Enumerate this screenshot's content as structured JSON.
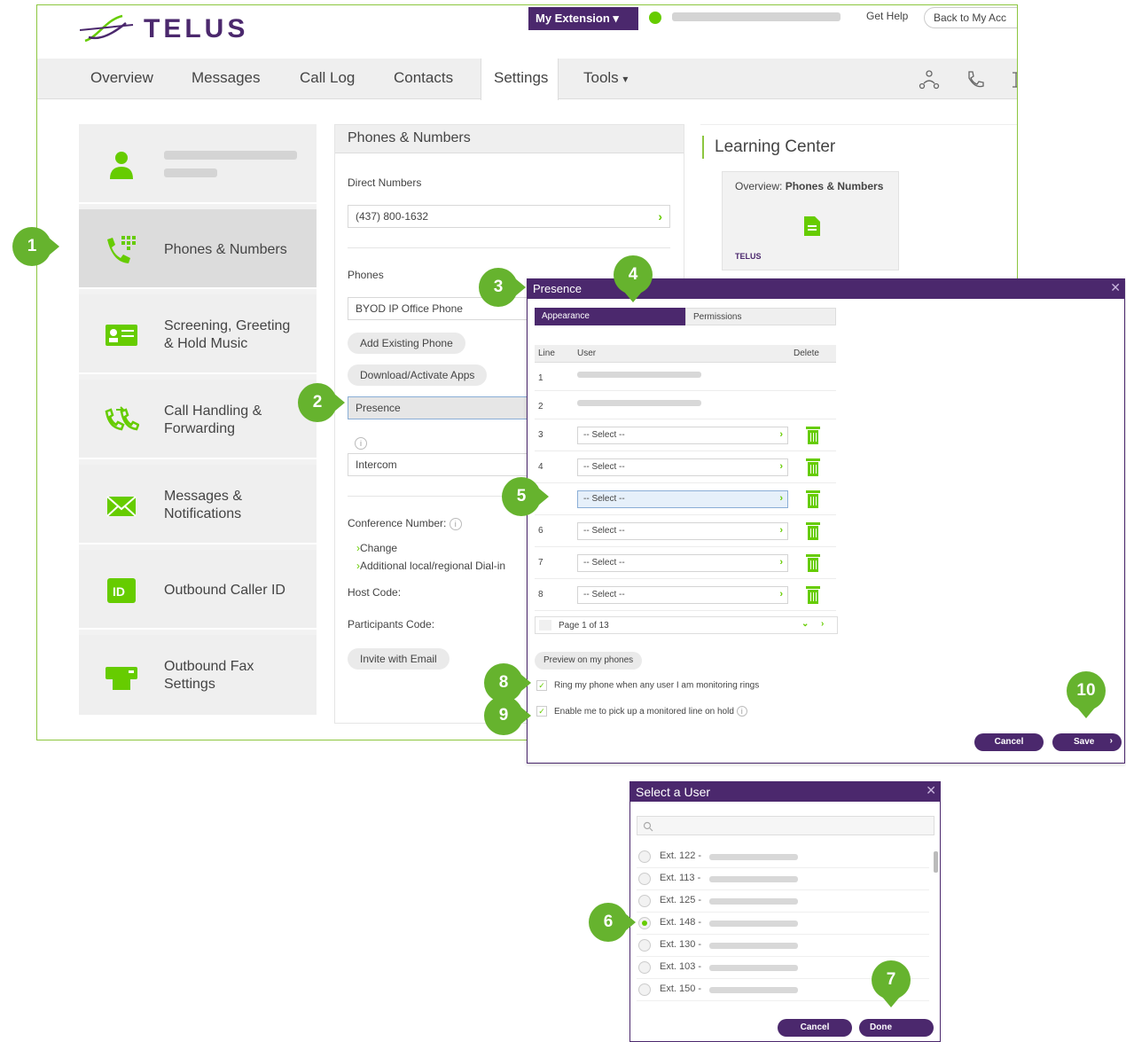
{
  "brand": {
    "logo_text": "TELUS",
    "accent": "#4b286d",
    "green": "#66cc00"
  },
  "topbar": {
    "extension_menu": "My Extension",
    "get_help": "Get Help",
    "back_link": "Back to My Acc"
  },
  "nav": {
    "items": [
      "Overview",
      "Messages",
      "Call Log",
      "Contacts",
      "Settings",
      "Tools"
    ],
    "active": "Settings"
  },
  "sidebar": {
    "items": [
      {
        "label": ""
      },
      {
        "label": "Phones & Numbers"
      },
      {
        "label": "Screening, Greeting",
        "label2": "& Hold Music"
      },
      {
        "label": "Call Handling &",
        "label2": "Forwarding"
      },
      {
        "label": "Messages &",
        "label2": "Notifications"
      },
      {
        "label": "Outbound Caller ID"
      },
      {
        "label": "Outbound Fax",
        "label2": "Settings"
      }
    ]
  },
  "phones_panel": {
    "title": "Phones & Numbers",
    "direct_numbers_label": "Direct Numbers",
    "direct_number": "(437) 800-1632",
    "phones_label": "Phones",
    "phone": "BYOD IP Office Phone",
    "add_existing": "Add Existing Phone",
    "download_apps": "Download/Activate Apps",
    "presence": "Presence",
    "intercom": "Intercom",
    "conference_label": "Conference Number:",
    "change": "Change",
    "dialin": "Additional local/regional Dial-in",
    "host_code": "Host Code:",
    "participants_code": "Participants Code:",
    "invite": "Invite with Email"
  },
  "learning_center": {
    "title": "Learning Center",
    "card_text": "Overview: ",
    "card_bold": "Phones & Numbers",
    "card_logo": "TELUS"
  },
  "presence_dialog": {
    "title": "Presence",
    "tabs": [
      "Appearance",
      "Permissions"
    ],
    "columns": [
      "Line",
      "User",
      "Delete"
    ],
    "rows": [
      {
        "line": "1",
        "type": "user"
      },
      {
        "line": "2",
        "type": "user"
      },
      {
        "line": "3",
        "type": "select",
        "value": "-- Select --"
      },
      {
        "line": "4",
        "type": "select",
        "value": "-- Select --"
      },
      {
        "line": "",
        "type": "select",
        "value": "-- Select --",
        "highlight": true
      },
      {
        "line": "6",
        "type": "select",
        "value": "-- Select --"
      },
      {
        "line": "7",
        "type": "select",
        "value": "-- Select --"
      },
      {
        "line": "8",
        "type": "select",
        "value": "-- Select --"
      }
    ],
    "pager": "Page 1 of 13",
    "preview": "Preview on my phones",
    "ring_option": "Ring my phone when any user I am monitoring rings",
    "pickup_option": "Enable me to pick up a monitored line on hold",
    "cancel": "Cancel",
    "save": "Save"
  },
  "select_user_dialog": {
    "title": "Select a User",
    "users": [
      {
        "ext": "Ext. 122 -",
        "selected": false
      },
      {
        "ext": "Ext. 113 -",
        "selected": false
      },
      {
        "ext": "Ext. 125 -",
        "selected": false
      },
      {
        "ext": "Ext. 148 -",
        "selected": true
      },
      {
        "ext": "Ext. 130 -",
        "selected": false
      },
      {
        "ext": "Ext. 103 -",
        "selected": false
      },
      {
        "ext": "Ext. 150 -",
        "selected": false
      }
    ],
    "cancel": "Cancel",
    "done": "Done"
  },
  "callouts": [
    "1",
    "2",
    "3",
    "4",
    "5",
    "6",
    "7",
    "8",
    "9",
    "10"
  ]
}
